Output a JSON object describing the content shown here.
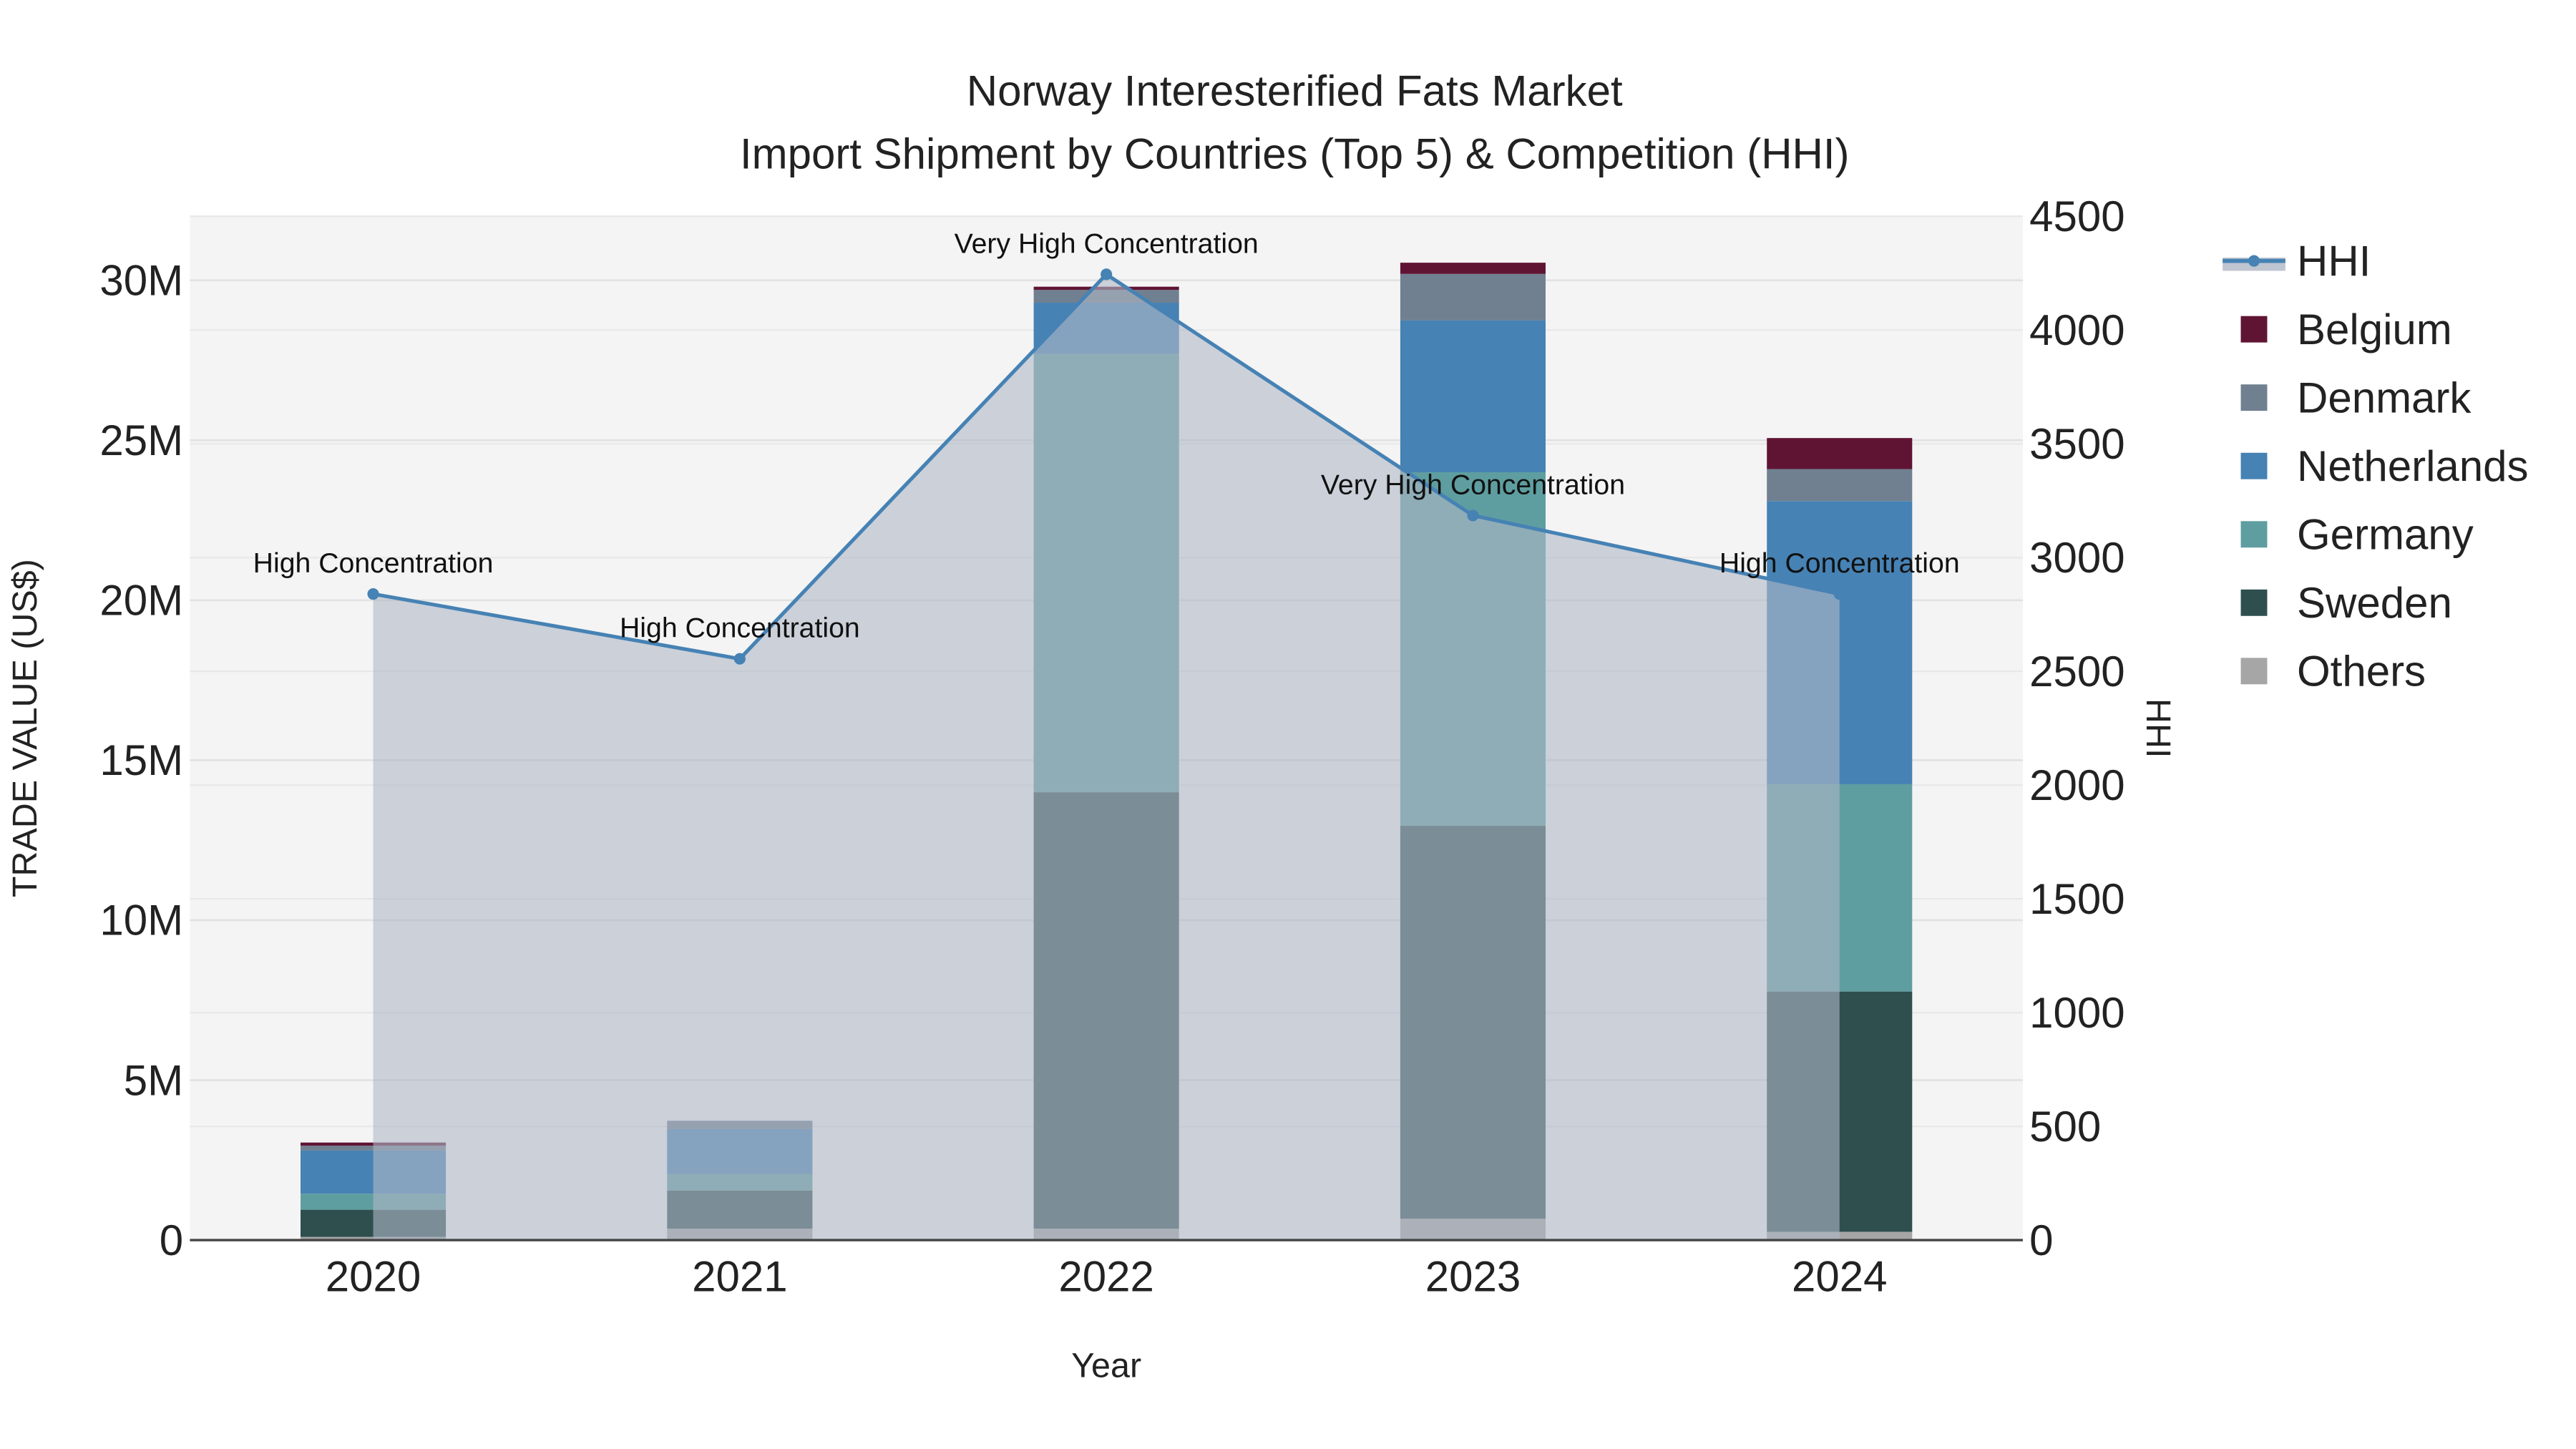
{
  "chart_data": {
    "type": "bar",
    "title_line1": "Norway Interesterified Fats Market",
    "title_line2": "Import Shipment by Countries (Top 5) & Competition (HHI)",
    "xlabel": "Year",
    "ylabel": "TRADE VALUE (US$)",
    "y2label": "HHI",
    "categories": [
      "2020",
      "2021",
      "2022",
      "2023",
      "2024"
    ],
    "ylim": [
      0,
      32000000
    ],
    "y_ticks": [
      0,
      5000000,
      10000000,
      15000000,
      20000000,
      25000000,
      30000000
    ],
    "y_tick_labels": [
      "0",
      "5M",
      "10M",
      "15M",
      "20M",
      "25M",
      "30M"
    ],
    "y2lim": [
      0,
      4500
    ],
    "y2_ticks": [
      0,
      500,
      1000,
      1500,
      2000,
      2500,
      3000,
      3500,
      4000,
      4500
    ],
    "y2_tick_labels": [
      "0",
      "500",
      "1000",
      "1500",
      "2000",
      "2500",
      "3000",
      "3500",
      "4000",
      "4500"
    ],
    "series": [
      {
        "name": "Others",
        "color": "#a6a6a6",
        "values": [
          100000,
          360000,
          360000,
          670000,
          260000
        ]
      },
      {
        "name": "Sweden",
        "color": "#2f4f4f",
        "values": [
          850000,
          1190000,
          13640000,
          12280000,
          7510000
        ]
      },
      {
        "name": "Germany",
        "color": "#5f9ea0",
        "values": [
          500000,
          520000,
          13700000,
          11050000,
          6480000
        ]
      },
      {
        "name": "Netherlands",
        "color": "#4682b4",
        "values": [
          1350000,
          1400000,
          1600000,
          4750000,
          8850000
        ]
      },
      {
        "name": "Denmark",
        "color": "#708090",
        "values": [
          150000,
          260000,
          400000,
          1450000,
          1000000
        ]
      },
      {
        "name": "Belgium",
        "color": "#601434",
        "values": [
          100000,
          0,
          100000,
          350000,
          970000
        ]
      }
    ],
    "hhi": {
      "name": "HHI",
      "color": "#4682b4",
      "values": [
        2840,
        2555,
        4245,
        3185,
        2840
      ],
      "annotations": [
        "High Concentration",
        "High Concentration",
        "Very High Concentration",
        "Very High Concentration",
        "High Concentration"
      ]
    },
    "legend_order": [
      "HHI",
      "Belgium",
      "Denmark",
      "Netherlands",
      "Germany",
      "Sweden",
      "Others"
    ],
    "legend_placement": "right",
    "grid": true
  }
}
